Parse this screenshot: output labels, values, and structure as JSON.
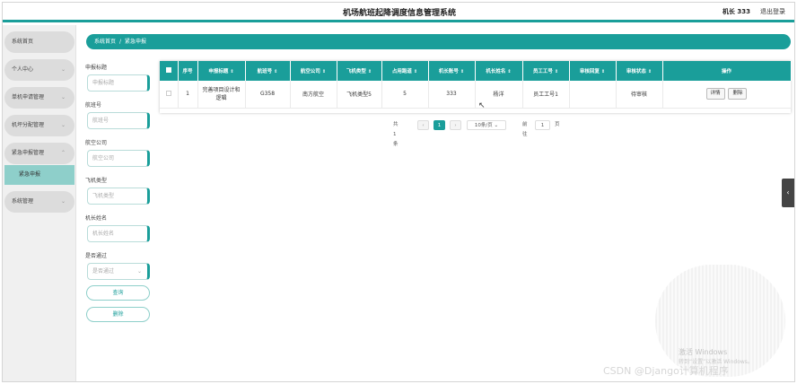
{
  "header": {
    "title": "机场航班起降调度信息管理系统",
    "user": "机长 333",
    "logout": "退出登录"
  },
  "sidebar": {
    "items": [
      {
        "label": "系统首页",
        "expandable": false
      },
      {
        "label": "个人中心",
        "expandable": true
      },
      {
        "label": "单机申请管理",
        "expandable": true
      },
      {
        "label": "机坪分配管理",
        "expandable": true
      },
      {
        "label": "紧急申报管理",
        "expandable": true
      },
      {
        "label": "系统管理",
        "expandable": true
      }
    ],
    "active_sub": "紧急申报"
  },
  "breadcrumb": {
    "home": "系统首页",
    "separator": "/",
    "current": "紧急申报"
  },
  "filters": {
    "fields": [
      {
        "label": "申报标题",
        "placeholder": "申报标题"
      },
      {
        "label": "航班号",
        "placeholder": "航班号"
      },
      {
        "label": "航空公司",
        "placeholder": "航空公司"
      },
      {
        "label": "飞机类型",
        "placeholder": "飞机类型"
      },
      {
        "label": "机长姓名",
        "placeholder": "机长姓名"
      },
      {
        "label": "是否通过",
        "placeholder": "是否通过"
      }
    ],
    "search_button": "查询",
    "delete_button": "删除"
  },
  "table": {
    "columns": [
      "序号",
      "申报标题",
      "航班号",
      "航空公司",
      "飞机类型",
      "占用跑道",
      "机长账号",
      "机长姓名",
      "员工工号",
      "审核回复",
      "审核状态",
      "操作"
    ],
    "rows": [
      {
        "index": "1",
        "title": "完善项目设计和逻辑",
        "flight": "G358",
        "airline": "南方航空",
        "aircraft": "飞机类型5",
        "runway": "5",
        "captain_account": "333",
        "captain_name": "杨洋",
        "staff_id": "员工工号1",
        "review_reply": "",
        "review_status": "待审核",
        "detail_btn": "详情",
        "delete_btn": "删除"
      }
    ]
  },
  "pagination": {
    "total": "共 1 条",
    "prev": "‹",
    "current_page": "1",
    "next": "›",
    "page_size": "10条/页",
    "goto_label": "前往",
    "goto_value": "1",
    "page_unit": "页"
  },
  "overlay": {
    "collapse_icon": "chevron-left-icon",
    "collapse_glyph": "‹",
    "activate_line1": "激活 Windows",
    "activate_line2": "转到“设置”以激活 Windows。",
    "watermark_text": "CSDN @Django计算机程序"
  },
  "colors": {
    "accent": "#1a9e9a",
    "active_sub_bg": "#8ecfca",
    "nav_bg": "#dcdcdc"
  }
}
